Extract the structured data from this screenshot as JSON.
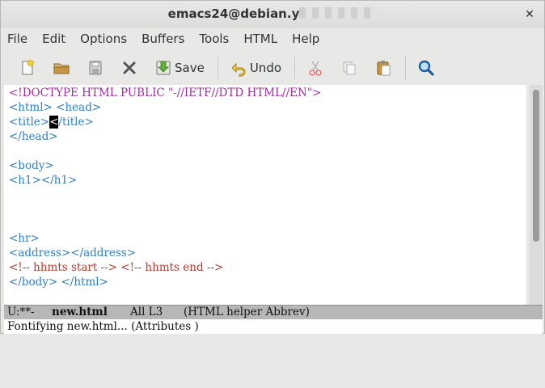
{
  "window": {
    "title": "emacs24@debian.y",
    "close_symbol": "✕"
  },
  "menubar": {
    "items": [
      "File",
      "Edit",
      "Options",
      "Buffers",
      "Tools",
      "HTML",
      "Help"
    ]
  },
  "toolbar": {
    "save_label": "Save",
    "undo_label": "Undo",
    "icons": [
      "new-file-icon",
      "open-folder-icon",
      "save-buffer-icon",
      "close-icon",
      "save-icon",
      "undo-icon",
      "cut-icon",
      "copy-icon",
      "paste-icon",
      "search-icon"
    ]
  },
  "editor": {
    "lines": [
      {
        "text": "<!DOCTYPE HTML PUBLIC \"-//IETF//DTD HTML//EN\">",
        "kind": "doctype"
      },
      {
        "text": "<html> <head>",
        "kind": "tag"
      },
      {
        "pre": "<title>",
        "cursor": "<",
        "post": "/title>",
        "kind": "cursor"
      },
      {
        "text": "</head>",
        "kind": "tag"
      },
      {
        "text": "",
        "kind": "tag"
      },
      {
        "text": "<body>",
        "kind": "tag"
      },
      {
        "text": "<h1></h1>",
        "kind": "tag"
      },
      {
        "text": "",
        "kind": "tag"
      },
      {
        "text": "",
        "kind": "tag"
      },
      {
        "text": "",
        "kind": "tag"
      },
      {
        "text": "<hr>",
        "kind": "tag"
      },
      {
        "text": "<address></address>",
        "kind": "tag"
      },
      {
        "text": "<!-- hhmts start --> <!-- hhmts end -->",
        "kind": "comment"
      },
      {
        "text": "</body> </html>",
        "kind": "tag"
      }
    ],
    "colors": {
      "tag": "#2d7fc4",
      "doctype": "#a42ba8",
      "comment": "#b23a2c"
    }
  },
  "modeline": {
    "status": "U:**-",
    "buffer": "new.html",
    "position": "All L3",
    "mode": "(HTML helper Abbrev)"
  },
  "echo": {
    "message": "Fontifying new.html... (Attributes )"
  }
}
